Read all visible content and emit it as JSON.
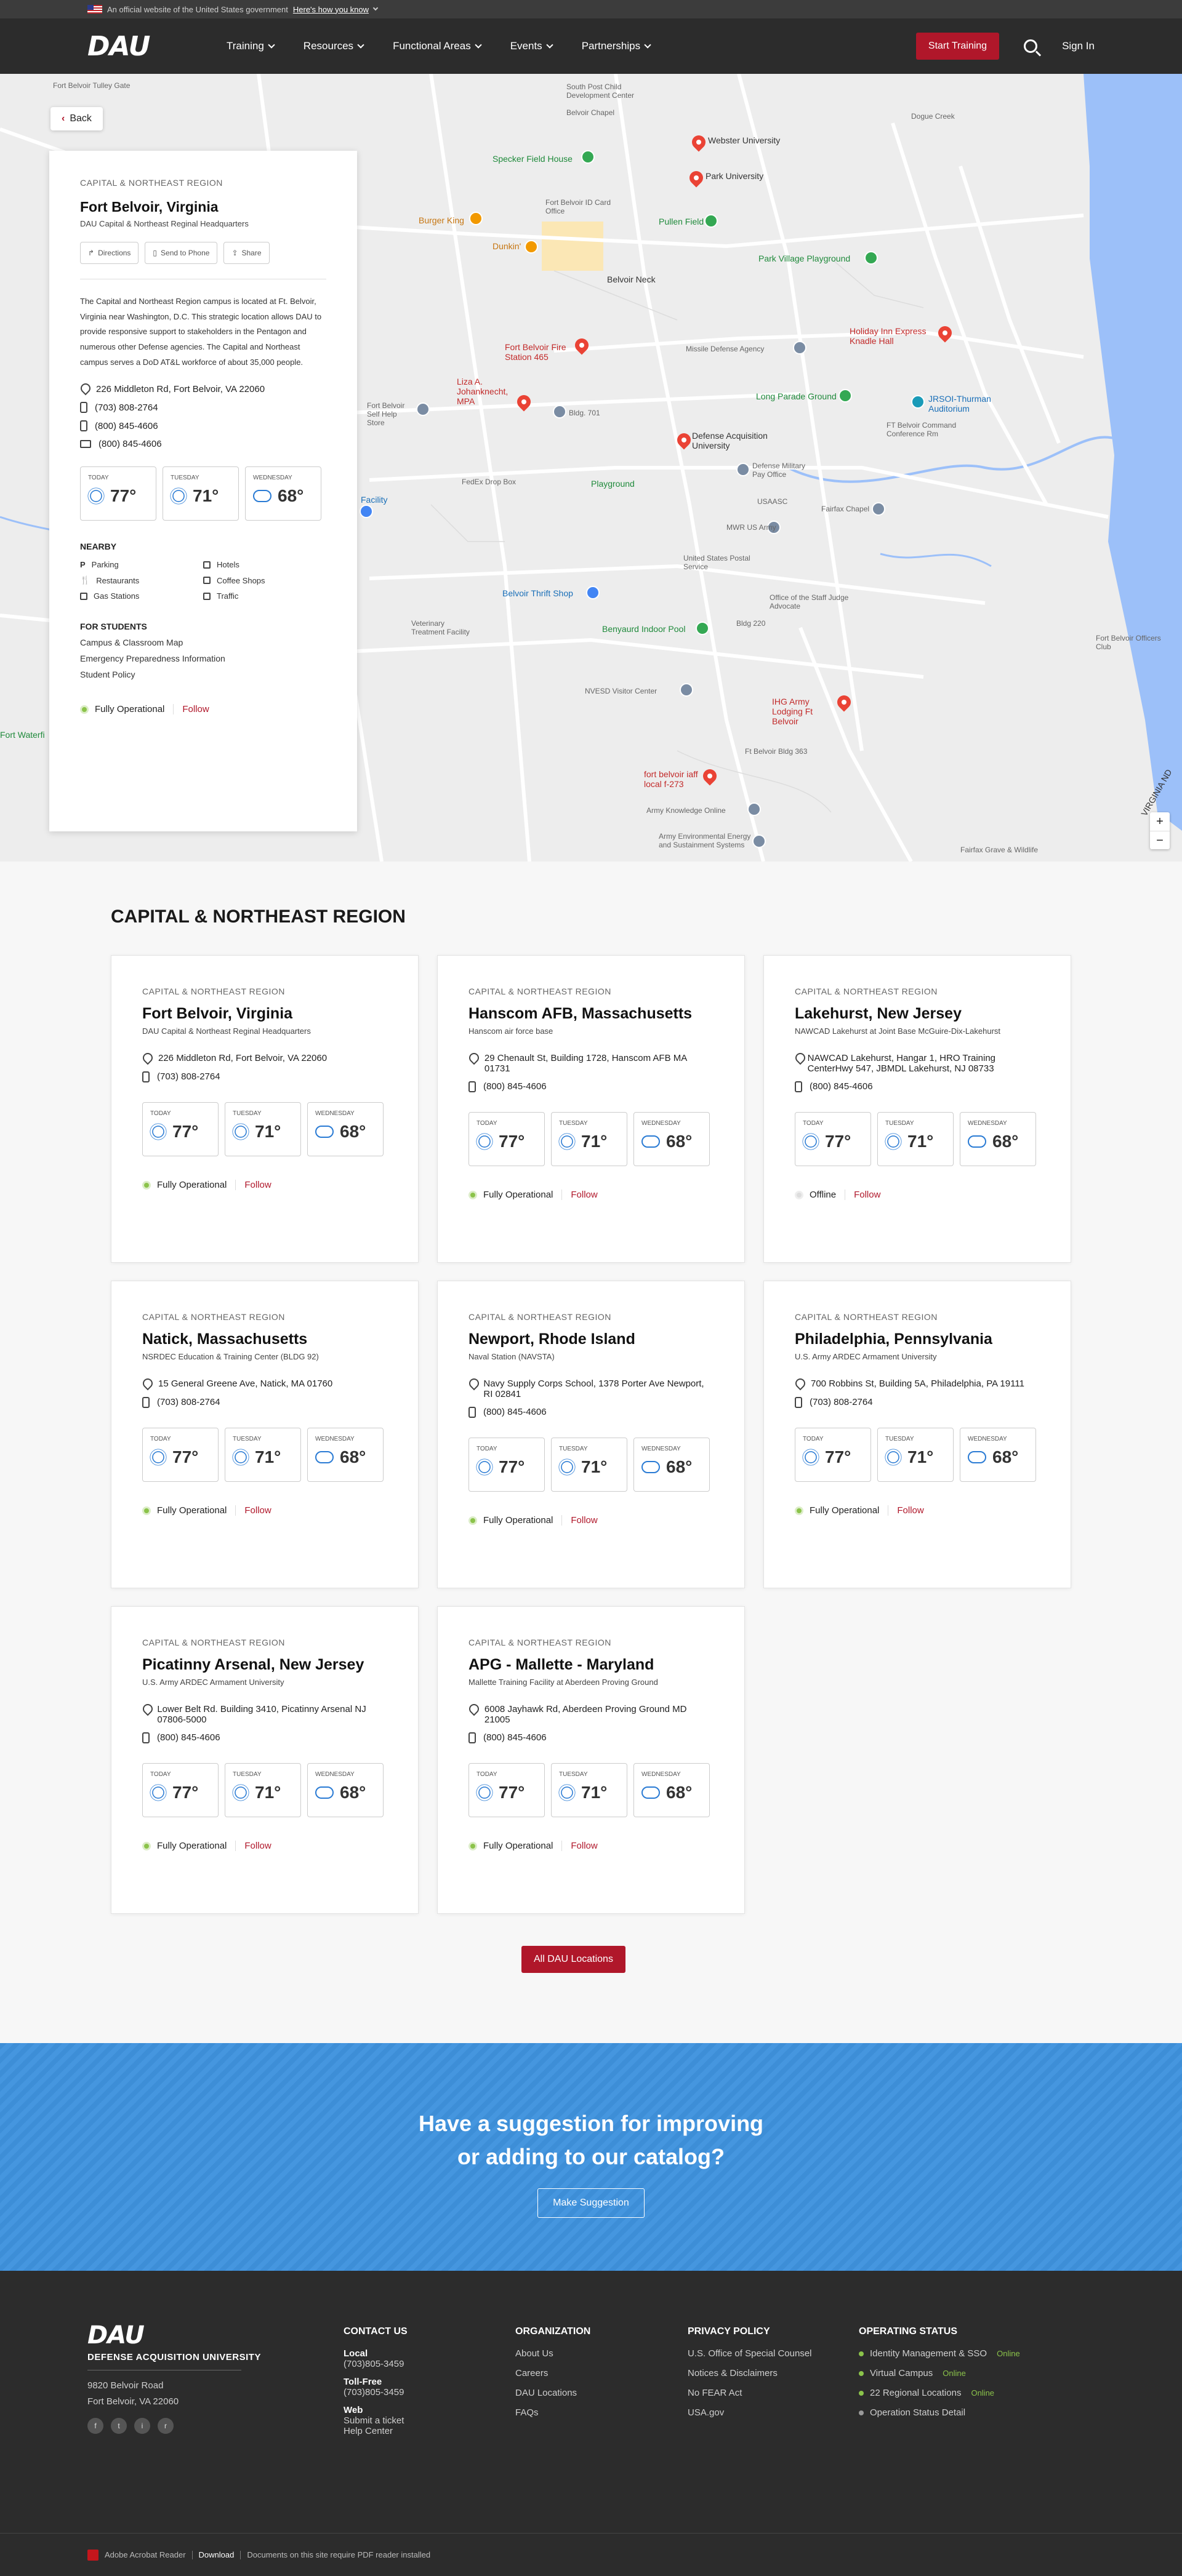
{
  "gov_banner": {
    "text": "An official website of the United States government",
    "link": "Here's how you know"
  },
  "nav": {
    "logo": "DAU",
    "items": [
      "Training",
      "Resources",
      "Functional Areas",
      "Events",
      "Partnerships"
    ],
    "cta": "Start Training",
    "signin": "Sign In"
  },
  "map": {
    "back": "Back",
    "labels": [
      {
        "t": "Fort Belvoir Tulley Gate",
        "c": "gray"
      },
      {
        "t": "South Post Child Development Center",
        "c": "gray"
      },
      {
        "t": "Belvoir Chapel",
        "c": "gray"
      },
      {
        "t": "Webster University",
        "c": "dark"
      },
      {
        "t": "Park University",
        "c": "dark"
      },
      {
        "t": "Dogue Creek",
        "c": "gray"
      },
      {
        "t": "Specker Field House",
        "c": "green"
      },
      {
        "t": "Fort Belvoir ID Card Office",
        "c": "gray"
      },
      {
        "t": "Burger King",
        "c": "orange"
      },
      {
        "t": "Dunkin'",
        "c": "orange"
      },
      {
        "t": "Pullen Field",
        "c": "green"
      },
      {
        "t": "Park Village Playground",
        "c": "green"
      },
      {
        "t": "Belvoir Neck",
        "c": "dark"
      },
      {
        "t": "Holiday Inn Express Knadle Hall",
        "c": "red"
      },
      {
        "t": "Fort Belvoir Fire Station 465",
        "c": "red"
      },
      {
        "t": "Missile Defense Agency",
        "c": "gray"
      },
      {
        "t": "Liza A. Johanknecht, MPA",
        "c": "red"
      },
      {
        "t": "Bldg. 701",
        "c": "gray"
      },
      {
        "t": "Long Parade Ground",
        "c": "green"
      },
      {
        "t": "JRSOI-Thurman Auditorium",
        "c": "blue"
      },
      {
        "t": "FT Belvoir Command Conference Rm",
        "c": "gray"
      },
      {
        "t": "Fort Belvoir Self Help Store",
        "c": "gray"
      },
      {
        "t": "Defense Acquisition University",
        "c": "dark"
      },
      {
        "t": "FedEx Drop Box",
        "c": "gray"
      },
      {
        "t": "Playground",
        "c": "green"
      },
      {
        "t": "Defense Military Pay Office",
        "c": "gray"
      },
      {
        "t": "USAASC",
        "c": "gray"
      },
      {
        "t": "Fairfax Chapel",
        "c": "gray"
      },
      {
        "t": "MWR US Army",
        "c": "gray"
      },
      {
        "t": "United States Postal Service",
        "c": "gray"
      },
      {
        "t": "Office of the Staff Judge Advocate",
        "c": "gray"
      },
      {
        "t": "Belvoir Thrift Shop",
        "c": "blue"
      },
      {
        "t": "Veterinary Treatment Facility",
        "c": "gray"
      },
      {
        "t": "Benyaurd Indoor Pool",
        "c": "green"
      },
      {
        "t": "Bldg 220",
        "c": "gray"
      },
      {
        "t": "Fort Belvoir Officers Club",
        "c": "gray"
      },
      {
        "t": "NVESD Visitor Center",
        "c": "gray"
      },
      {
        "t": "IHG Army Lodging Ft Belvoir",
        "c": "red"
      },
      {
        "t": "Ft Belvoir Bldg 363",
        "c": "gray"
      },
      {
        "t": "fort belvoir iaff local f-273",
        "c": "red"
      },
      {
        "t": "Army Knowledge Online",
        "c": "gray"
      },
      {
        "t": "Army Environmental Energy and Sustainment Systems",
        "c": "gray"
      },
      {
        "t": "Fairfax Grave & Wildlife",
        "c": "gray"
      },
      {
        "t": "Facility",
        "c": "blue"
      },
      {
        "t": "Fort Waterfi",
        "c": "green"
      },
      {
        "t": "VIRGINIA ND",
        "c": "dark"
      }
    ]
  },
  "panel": {
    "region": "CAPITAL & NORTHEAST REGION",
    "title": "Fort Belvoir, Virginia",
    "subtitle": "DAU Capital & Northeast Reginal Headquarters",
    "btn_directions": "Directions",
    "btn_phone": "Send to Phone",
    "btn_share": "Share",
    "description": "The Capital and Northeast Region campus is located at Ft. Belvoir, Virginia near Washington, D.C. This strategic location allows DAU to provide responsive support to stakeholders in the Pentagon and numerous other Defense agencies. The Capital and Northeast campus serves a DoD AT&L workforce of about 35,000 people.",
    "address": "226 Middleton Rd, Fort Belvoir, VA 22060",
    "phone1": "(703) 808-2764",
    "phone2": "(800) 845-4606",
    "fax": "(800) 845-4606",
    "weather": [
      {
        "day": "TODAY",
        "temp": "77°",
        "icon": "sun"
      },
      {
        "day": "TUESDAY",
        "temp": "71°",
        "icon": "sun"
      },
      {
        "day": "WEDNESDAY",
        "temp": "68°",
        "icon": "cloud"
      }
    ],
    "nearby_h": "NEARBY",
    "nearby": [
      "Parking",
      "Hotels",
      "Restaurants",
      "Coffee Shops",
      "Gas Stations",
      "Traffic"
    ],
    "students_h": "FOR STUDENTS",
    "students": [
      "Campus & Classroom Map",
      "Emergency Preparedness Information",
      "Student Policy"
    ],
    "status": "Fully Operational",
    "follow": "Follow"
  },
  "region": {
    "heading": "CAPITAL & NORTHEAST REGION",
    "cards": [
      {
        "region": "CAPITAL & NORTHEAST REGION",
        "title": "Fort Belvoir, Virginia",
        "sub": "DAU Capital & Northeast Reginal Headquarters",
        "addr": "226 Middleton Rd, Fort Belvoir, VA 22060",
        "phone": "(703) 808-2764",
        "temps": [
          "77°",
          "71°",
          "68°"
        ],
        "status": "Fully Operational",
        "online": true
      },
      {
        "region": "CAPITAL & NORTHEAST REGION",
        "title": "Hanscom AFB, Massachusetts",
        "sub": "Hanscom air force base",
        "addr": "29 Chenault St, Building 1728, Hanscom AFB MA 01731",
        "phone": "(800) 845-4606",
        "temps": [
          "77°",
          "71°",
          "68°"
        ],
        "status": "Fully Operational",
        "online": true
      },
      {
        "region": "CAPITAL & NORTHEAST REGION",
        "title": "Lakehurst, New Jersey",
        "sub": "NAWCAD Lakehurst at Joint Base McGuire-Dix-Lakehurst",
        "addr": "NAWCAD Lakehurst, Hangar 1, HRO Training CenterHwy 547, JBMDL Lakehurst, NJ 08733",
        "phone": "(800) 845-4606",
        "temps": [
          "77°",
          "71°",
          "68°"
        ],
        "status": "Offline",
        "online": false
      },
      {
        "region": "CAPITAL & NORTHEAST REGION",
        "title": "Natick, Massachusetts",
        "sub": "NSRDEC Education & Training Center (BLDG 92)",
        "addr": "15 General Greene Ave, Natick, MA 01760",
        "phone": "(703) 808-2764",
        "temps": [
          "77°",
          "71°",
          "68°"
        ],
        "status": "Fully Operational",
        "online": true
      },
      {
        "region": "CAPITAL & NORTHEAST REGION",
        "title": "Newport, Rhode Island",
        "sub": "Naval Station (NAVSTA)",
        "addr": "Navy Supply Corps School, 1378 Porter Ave Newport, RI 02841",
        "phone": "(800) 845-4606",
        "temps": [
          "77°",
          "71°",
          "68°"
        ],
        "status": "Fully Operational",
        "online": true
      },
      {
        "region": "CAPITAL & NORTHEAST REGION",
        "title": "Philadelphia, Pennsylvania",
        "sub": "U.S. Army ARDEC Armament University",
        "addr": "700 Robbins St, Building 5A, Philadelphia, PA 19111",
        "phone": "(703) 808-2764",
        "temps": [
          "77°",
          "71°",
          "68°"
        ],
        "status": "Fully Operational",
        "online": true
      },
      {
        "region": "CAPITAL & NORTHEAST REGION",
        "title": "Picatinny Arsenal, New Jersey",
        "sub": "U.S. Army ARDEC Armament University",
        "addr": "Lower Belt Rd. Building 3410, Picatinny Arsenal NJ 07806-5000",
        "phone": "(800) 845-4606",
        "temps": [
          "77°",
          "71°",
          "68°"
        ],
        "status": "Fully Operational",
        "online": true
      },
      {
        "region": "CAPITAL & NORTHEAST REGION",
        "title": "APG - Mallette - Maryland",
        "sub": "Mallette Training Facility at Aberdeen Proving Ground",
        "addr": "6008 Jayhawk Rd, Aberdeen Proving Ground MD 21005",
        "phone": "(800) 845-4606",
        "temps": [
          "77°",
          "71°",
          "68°"
        ],
        "status": "Fully Operational",
        "online": true
      }
    ],
    "weather_days": [
      "TODAY",
      "TUESDAY",
      "WEDNESDAY"
    ],
    "follow": "Follow",
    "all_button": "All DAU Locations"
  },
  "cta": {
    "line1": "Have a suggestion for improving",
    "line2": "or adding to our catalog?",
    "button": "Make Suggestion"
  },
  "footer": {
    "logo": "DAU",
    "full_name": "DEFENSE ACQUISITION UNIVERSITY",
    "addr1": "9820 Belvoir Road",
    "addr2": "Fort Belvoir, VA 22060",
    "socials": [
      "f",
      "t",
      "i",
      "r"
    ],
    "contact": {
      "h": "CONTACT US",
      "local_h": "Local",
      "local": "(703)805-3459",
      "tollfree_h": "Toll-Free",
      "tollfree": "(703)805-3459",
      "web_h": "Web",
      "web1": "Submit a ticket",
      "web2": "Help Center"
    },
    "org": {
      "h": "ORGANIZATION",
      "links": [
        "About Us",
        "Careers",
        "DAU Locations",
        "FAQs"
      ]
    },
    "privacy": {
      "h": "PRIVACY POLICY",
      "links": [
        "U.S. Office of Special Counsel",
        "Notices & Disclaimers",
        "No FEAR Act",
        "USA.gov"
      ]
    },
    "opstatus": {
      "h": "OPERATING STATUS",
      "items": [
        {
          "t": "Identity Management & SSO",
          "s": "Online"
        },
        {
          "t": "Virtual Campus",
          "s": "Online"
        },
        {
          "t": "22 Regional Locations",
          "s": "Online"
        },
        {
          "t": "Operation Status Detail",
          "s": ""
        }
      ]
    }
  },
  "bottom": {
    "reader": "Adobe Acrobat Reader",
    "download": "Download",
    "note": "Documents on this site require PDF reader installed"
  }
}
